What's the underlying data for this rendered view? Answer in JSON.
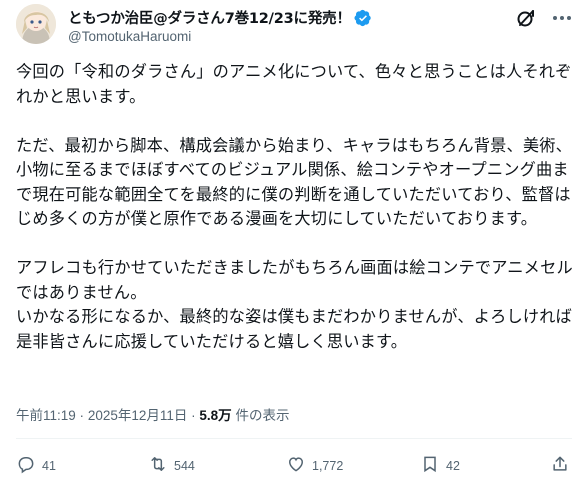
{
  "author": {
    "display_name": "ともつか治臣@ダラさん7巻12/23に発売！",
    "handle": "@TomotukaHaruomi",
    "verified_icon": "verified-badge-icon",
    "avatar": "avatar-illustration"
  },
  "header_icons": [
    "grok-icon",
    "more-icon"
  ],
  "tweet": {
    "paragraphs": [
      "今回の「令和のダラさん」のアニメ化について、色々と思うことは人それぞれかと思います。",
      "ただ、最初から脚本、構成会議から始まり、キャラはもちろん背景、美術、小物に至るまでほぼすべてのビジュアル関係、絵コンテやオープニング曲まで現在可能な範囲全てを最終的に僕の判断を通していただいており、監督はじめ多くの方が僕と原作である漫画を大切にしていただいております。",
      "アフレコも行かせていただきましたがもちろん画面は絵コンテでアニメセルではありません。\nいかなる形になるか、最終的な姿は僕もまだわかりませんが、よろしければ是非皆さんに応援していただけると嬉しく思います。"
    ]
  },
  "meta": {
    "time": "午前11:19",
    "separator": "·",
    "date": "2025年12月11日",
    "views_count": "5.8万",
    "views_label": "件の表示"
  },
  "actions": {
    "reply_count": "41",
    "retweet_count": "544",
    "like_count": "1,772",
    "bookmark_count": "42"
  },
  "colors": {
    "text": "#0f1419",
    "secondary": "#536471",
    "verified": "#1d9bf0"
  }
}
